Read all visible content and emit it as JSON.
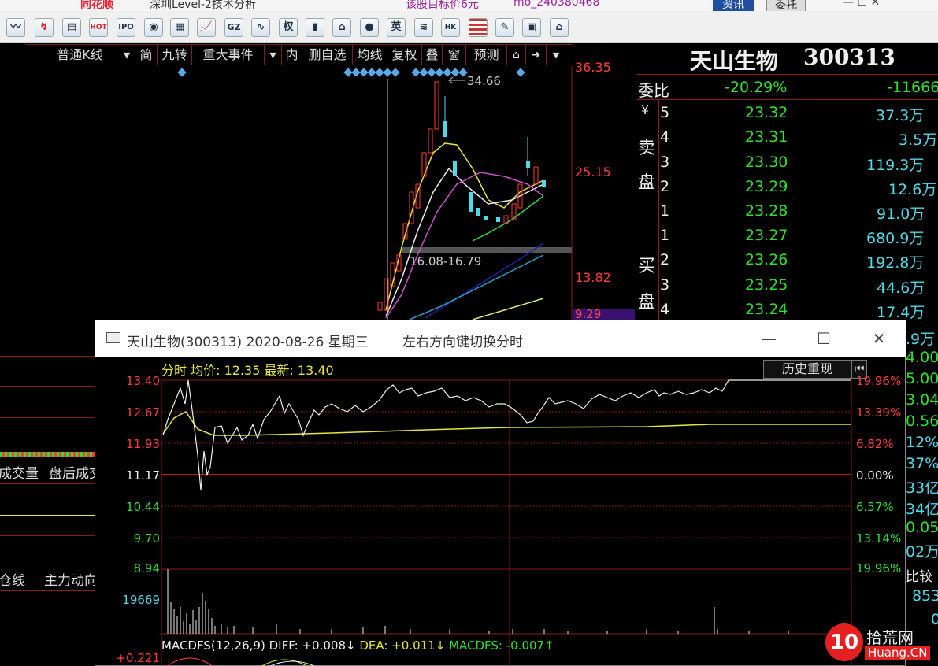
{
  "titlestrip": {
    "left": "深圳Level-2技术分析",
    "middle": "该股目标价6元",
    "right": "mo_240380468",
    "btn1": "资讯",
    "btn2": "委托"
  },
  "toolbar": {
    "icons": [
      "chart-line",
      "kline",
      "f10",
      "hot",
      "ipo",
      "globe",
      "stock-map",
      "trend",
      "gz",
      "wave",
      "quan",
      "book",
      "bank",
      "disk",
      "ying",
      "scroll",
      "hk",
      "us",
      "news",
      "calc",
      "home"
    ],
    "labels": {
      "ipo": "IPO",
      "gz": "GZ",
      "quan": "权",
      "ying": "英",
      "hk": "HK"
    }
  },
  "kline_bar": {
    "items": [
      "普通K线",
      "▾",
      "简",
      "九转",
      "重大事件",
      "▾",
      "内",
      "删自选",
      "均线",
      "复权",
      "叠",
      "窗",
      "预测",
      "🔒",
      "➜",
      "▾"
    ]
  },
  "kline": {
    "price_labels": [
      "36.35",
      "25.15",
      "13.82",
      "9.29"
    ],
    "high_marker": "34.66",
    "range_label": "16.08-16.79"
  },
  "quote": {
    "name": "天山生物",
    "code": "300313",
    "weibi_label": "委比",
    "weibi_pct": "-20.29%",
    "weicha": "-11666",
    "sell_label": [
      "¥",
      "卖",
      "盘"
    ],
    "buy_label": [
      "买",
      "盘"
    ],
    "asks": [
      {
        "level": "5",
        "price": "23.32",
        "vol": "37.3万"
      },
      {
        "level": "4",
        "price": "23.31",
        "vol": "3.5万"
      },
      {
        "level": "3",
        "price": "23.30",
        "vol": "119.3万"
      },
      {
        "level": "2",
        "price": "23.29",
        "vol": "12.6万"
      },
      {
        "level": "1",
        "price": "23.28",
        "vol": "91.0万"
      }
    ],
    "bids": [
      {
        "level": "1",
        "price": "23.27",
        "vol": "680.9万"
      },
      {
        "level": "2",
        "price": "23.26",
        "vol": "192.8万"
      },
      {
        "level": "3",
        "price": "23.25",
        "vol": "44.6万"
      },
      {
        "level": "4",
        "price": "23.24",
        "vol": "17.4万"
      }
    ],
    "side_values": [
      ".9万",
      "4.00",
      "5.00",
      "3.04",
      "0.56",
      "12%",
      "37%",
      "33亿",
      "34亿",
      "0.05",
      "02万",
      "比较",
      "853",
      "0"
    ]
  },
  "left_panel": {
    "btn_a": "成交量",
    "btn_b": "盘后成交",
    "btn_c": "仓线",
    "btn_d": "主力动向"
  },
  "popup": {
    "title": "天山生物(300313) 2020-08-26 星期三",
    "hint": "左右方向键切换分时",
    "header": "分时 均价: 12.35 最新: 13.40",
    "history_btn": "历史重现",
    "history_arrow": "⏮",
    "minimize": "—",
    "maximize": "☐",
    "close": "✕",
    "left_axis": [
      "13.40",
      "12.67",
      "11.93",
      "11.17",
      "10.44",
      "9.70",
      "8.94"
    ],
    "right_axis": [
      "19.96%",
      "13.39%",
      "6.82%",
      "0.00%",
      "6.57%",
      "13.14%",
      "19.96%"
    ],
    "volume_label": "19669",
    "macd": {
      "name": "MACDFS(12,26,9)",
      "diff": "DIFF: +0.008↓",
      "dea": "DEA: +0.011↓",
      "macdfs": "MACDFS: -0.007↑"
    },
    "macd_axis": "+0.221"
  },
  "watermark": {
    "logo": "10",
    "text": "拾荒网",
    "domain": "Huang.CN"
  },
  "colors": {
    "up": "#ff3c3c",
    "down": "#2de02d",
    "accent": "#4fd8e8",
    "avg": "#e6e63a"
  }
}
